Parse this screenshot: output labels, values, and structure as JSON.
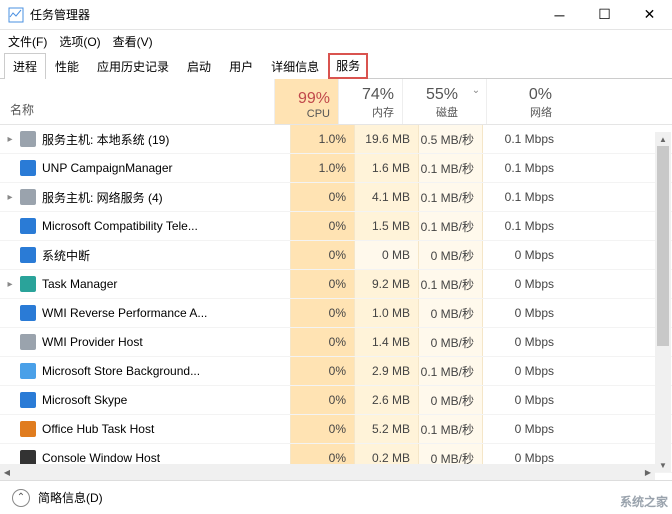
{
  "window": {
    "title": "任务管理器"
  },
  "menu": {
    "file": "文件(F)",
    "options": "选项(O)",
    "view": "查看(V)"
  },
  "tabs": [
    "进程",
    "性能",
    "应用历史记录",
    "启动",
    "用户",
    "详细信息",
    "服务"
  ],
  "activeTab": 0,
  "highlightedTab": 6,
  "columns": {
    "name": "名称",
    "metrics": [
      {
        "pct": "99%",
        "label": "CPU",
        "hot": true
      },
      {
        "pct": "74%",
        "label": "内存",
        "hot": false
      },
      {
        "pct": "55%",
        "label": "磁盘",
        "hot": false
      },
      {
        "pct": "0%",
        "label": "网络",
        "hot": false
      }
    ]
  },
  "processes": [
    {
      "expand": "▸",
      "icon": "gear",
      "name": "服务主机: 本地系统 (19)",
      "cpu": "1.0%",
      "mem": "19.6 MB",
      "disk": "0.5 MB/秒",
      "net": "0.1 Mbps"
    },
    {
      "expand": "",
      "icon": "blue",
      "name": "UNP CampaignManager",
      "cpu": "1.0%",
      "mem": "1.6 MB",
      "disk": "0.1 MB/秒",
      "net": "0.1 Mbps"
    },
    {
      "expand": "▸",
      "icon": "gear",
      "name": "服务主机: 网络服务 (4)",
      "cpu": "0%",
      "mem": "4.1 MB",
      "disk": "0.1 MB/秒",
      "net": "0.1 Mbps"
    },
    {
      "expand": "",
      "icon": "blue",
      "name": "Microsoft Compatibility Tele...",
      "cpu": "0%",
      "mem": "1.5 MB",
      "disk": "0.1 MB/秒",
      "net": "0.1 Mbps"
    },
    {
      "expand": "",
      "icon": "blue",
      "name": "系统中断",
      "cpu": "0%",
      "mem": "0 MB",
      "disk": "0 MB/秒",
      "net": "0 Mbps",
      "memzero": true
    },
    {
      "expand": "▸",
      "icon": "teal",
      "name": "Task Manager",
      "cpu": "0%",
      "mem": "9.2 MB",
      "disk": "0.1 MB/秒",
      "net": "0 Mbps"
    },
    {
      "expand": "",
      "icon": "blue",
      "name": "WMI Reverse Performance A...",
      "cpu": "0%",
      "mem": "1.0 MB",
      "disk": "0 MB/秒",
      "net": "0 Mbps"
    },
    {
      "expand": "",
      "icon": "gear",
      "name": "WMI Provider Host",
      "cpu": "0%",
      "mem": "1.4 MB",
      "disk": "0 MB/秒",
      "net": "0 Mbps"
    },
    {
      "expand": "",
      "icon": "win",
      "name": "Microsoft Store Background...",
      "cpu": "0%",
      "mem": "2.9 MB",
      "disk": "0.1 MB/秒",
      "net": "0 Mbps"
    },
    {
      "expand": "",
      "icon": "blue",
      "name": "Microsoft Skype",
      "cpu": "0%",
      "mem": "2.6 MB",
      "disk": "0 MB/秒",
      "net": "0 Mbps"
    },
    {
      "expand": "",
      "icon": "orange",
      "name": "Office Hub Task Host",
      "cpu": "0%",
      "mem": "5.2 MB",
      "disk": "0.1 MB/秒",
      "net": "0 Mbps"
    },
    {
      "expand": "",
      "icon": "dark",
      "name": "Console Window Host",
      "cpu": "0%",
      "mem": "0.2 MB",
      "disk": "0 MB/秒",
      "net": "0 Mbps"
    }
  ],
  "statusbar": {
    "fewer": "简略信息(D)"
  },
  "watermark": "系统之家"
}
